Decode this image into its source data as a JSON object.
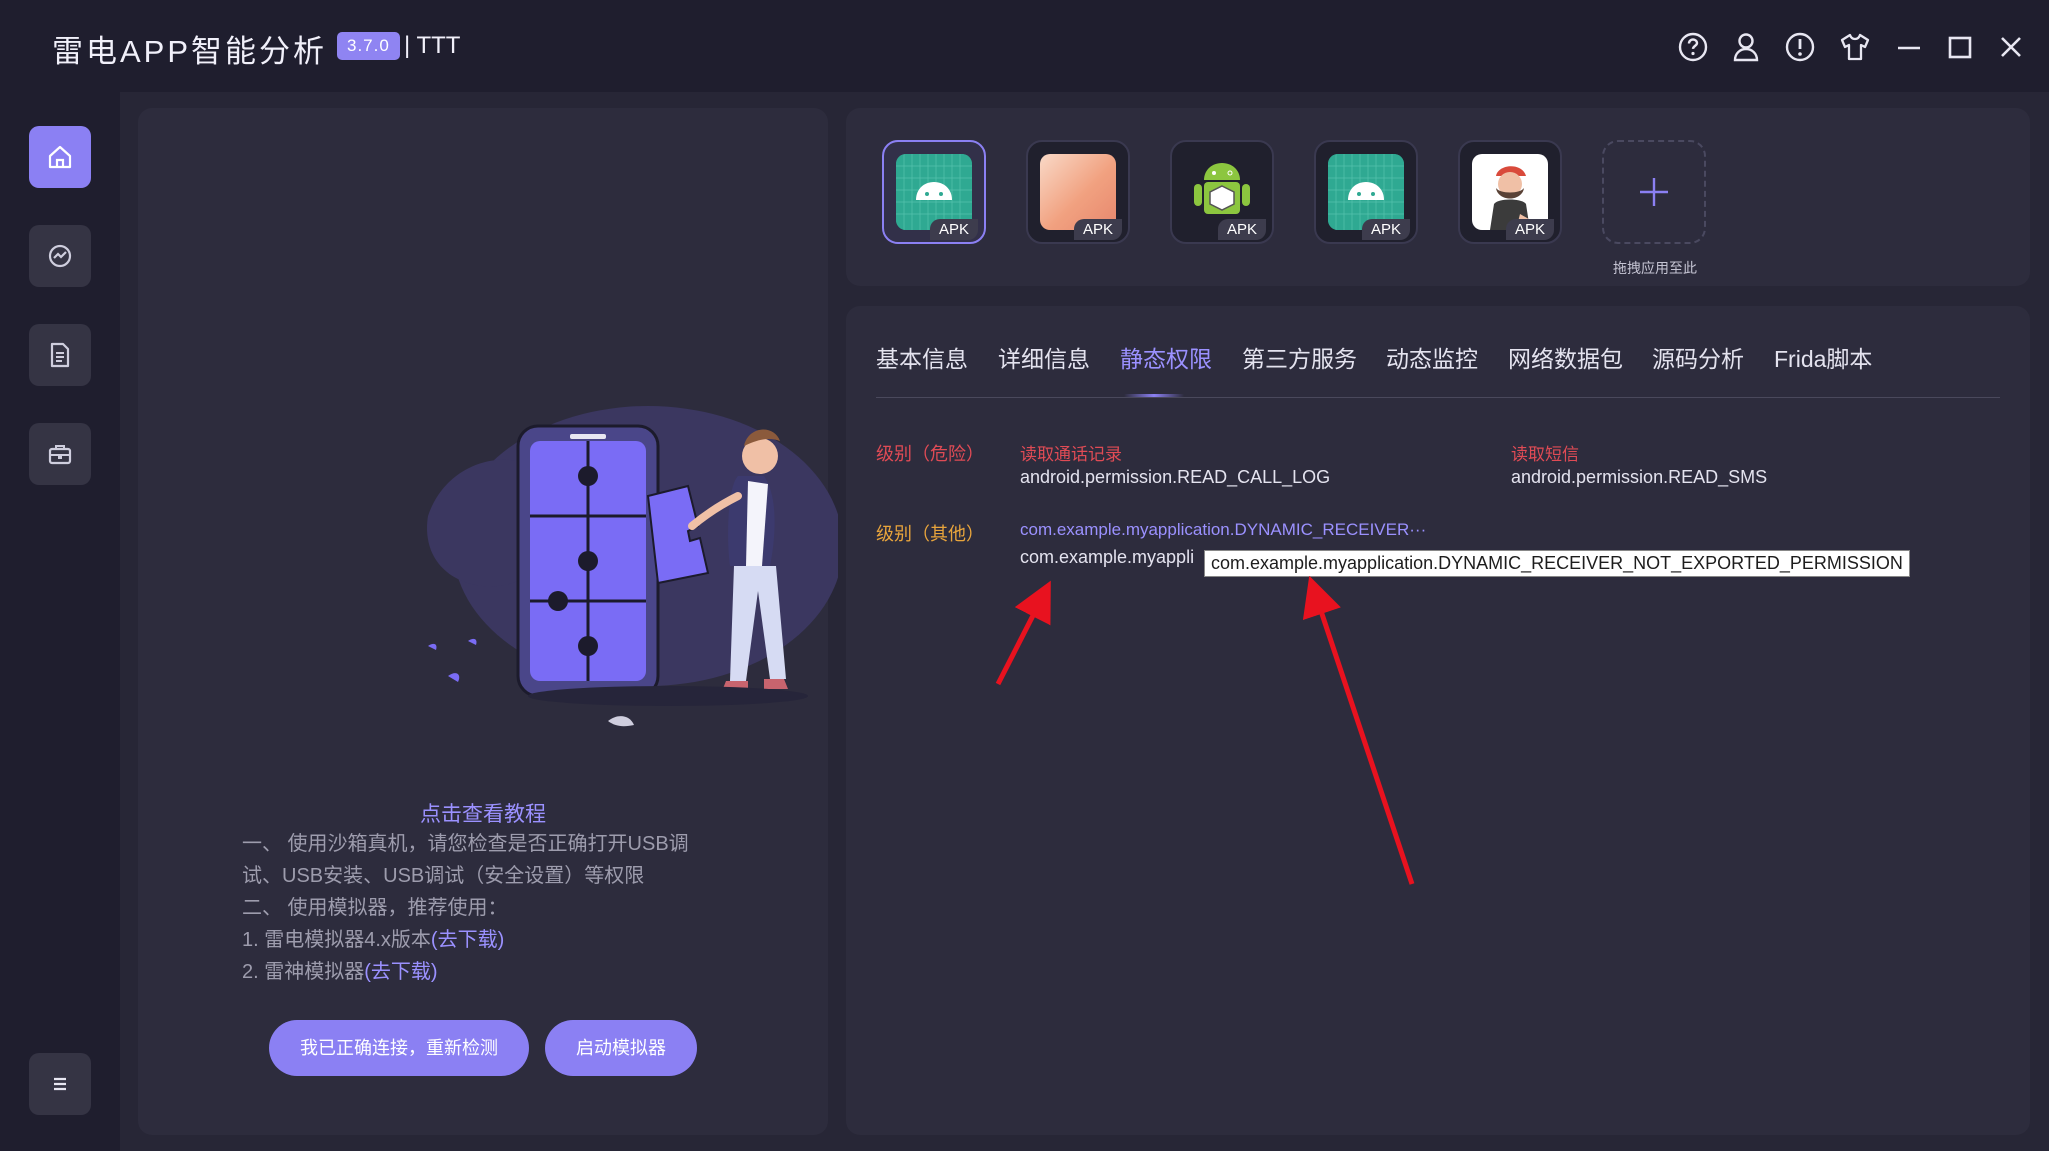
{
  "header": {
    "app_title": "雷电APP智能分析",
    "version": "3.7.0",
    "user": "| TTT",
    "icons": [
      "help-icon",
      "user-icon",
      "info-icon",
      "skin-icon",
      "minimize-icon",
      "maximize-icon",
      "close-icon"
    ]
  },
  "sidebar": {
    "items": [
      {
        "icon": "home-icon",
        "active": true
      },
      {
        "icon": "analysis-icon",
        "active": false
      },
      {
        "icon": "report-icon",
        "active": false
      },
      {
        "icon": "toolbox-icon",
        "active": false
      }
    ],
    "menu_icon": "menu-icon"
  },
  "left_panel": {
    "tutorial_link": "点击查看教程",
    "line1a": "一、 使用沙箱真机，请您检查是否正确打开USB调",
    "line1b": "试、USB安装、USB调试（安全设置）等权限",
    "line2": "二、 使用模拟器，推荐使用：",
    "line3_text": "1. 雷电模拟器4.x版本",
    "line3_link": "(去下载)",
    "line4_text": "2. 雷神模拟器",
    "line4_link": "(去下载)",
    "reconnect_button": "我已正确连接，重新检测",
    "emulator_button": "启动模拟器"
  },
  "apk_strip": {
    "tag": "APK",
    "drop_hint": "拖拽应用至此",
    "apps": [
      {
        "icon": "android-teal-icon",
        "selected": true
      },
      {
        "icon": "peach-swirl-icon",
        "selected": false
      },
      {
        "icon": "android-robot-box-icon",
        "selected": false
      },
      {
        "icon": "android-teal-icon",
        "selected": false
      },
      {
        "icon": "bearded-man-icon",
        "selected": false
      }
    ]
  },
  "tabs": [
    "基本信息",
    "详细信息",
    "静态权限",
    "第三方服务",
    "动态监控",
    "网络数据包",
    "源码分析",
    "Frida脚本"
  ],
  "active_tab": "静态权限",
  "permissions": {
    "danger_level": "级别（危险）",
    "danger": [
      {
        "name": "读取通话记录",
        "value": "android.permission.READ_CALL_LOG"
      },
      {
        "name": "读取短信",
        "value": "android.permission.READ_SMS"
      }
    ],
    "other_level": "级别（其他）",
    "other": [
      {
        "name": "com.example.myapplication.DYNAMIC_RECEIVER···",
        "value": "com.example.myappli"
      }
    ],
    "tooltip": "com.example.myapplication.DYNAMIC_RECEIVER_NOT_EXPORTED_PERMISSION"
  },
  "colors": {
    "accent": "#8b80f3",
    "danger": "#e04b55",
    "other": "#e9a53c",
    "link": "#9b91ff"
  }
}
